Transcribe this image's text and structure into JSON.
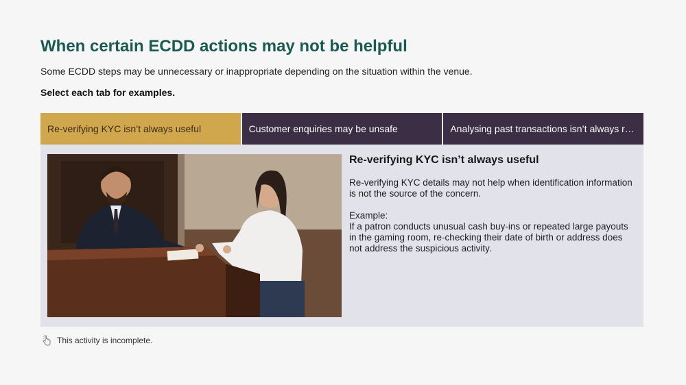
{
  "heading": "When certain ECDD actions may not be helpful",
  "intro": "Some ECDD steps may be unnecessary or inappropriate depending on the situation within the venue.",
  "instruction": "Select each tab for examples.",
  "tabs": [
    {
      "label": "Re-verifying KYC isn’t always useful",
      "active": true
    },
    {
      "label": "Customer enquiries may be unsafe",
      "active": false
    },
    {
      "label": "Analysing past transactions isn’t always rele...",
      "active": false
    }
  ],
  "panel": {
    "image_icon": "reception-desk-photo",
    "title": "Re-verifying KYC isn’t always useful",
    "paragraph": "Re-verifying KYC details may not help when identification information is not the source of the concern.",
    "example_label": "Example:",
    "example_text": "If a patron conducts unusual cash buy-ins or repeated large payouts in the gaming room, re-checking their date of birth or address does not address the suspicious activity."
  },
  "status": {
    "icon": "pointer-hand-icon",
    "text": "This activity is incomplete."
  },
  "colors": {
    "heading": "#1b5a52",
    "tab_active": "#d1a74e",
    "tab_inactive": "#3c2e45",
    "panel_bg": "#e2e2ea",
    "page_bg": "#f6f6f6"
  }
}
